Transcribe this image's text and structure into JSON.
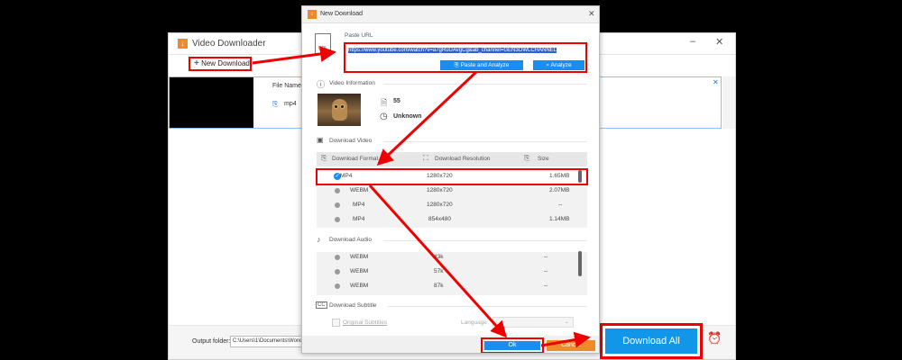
{
  "background_window": {
    "title": "Video Downloader",
    "minimize_glyph": "–",
    "close_glyph": "✕",
    "new_download_label": "New Download",
    "new_download_icon": "plus-icon",
    "item": {
      "file_name_label": "File Name:",
      "format": "mp4",
      "format_icon": "video-file-icon",
      "close_glyph": "✕"
    },
    "output_folder_label": "Output folder:",
    "output_folder_value": "C:\\Users\\1\\Documents\\Wonde",
    "download_all_label": "Download All",
    "alarm_icon": "alarm-clock-icon"
  },
  "dialog": {
    "title": "New Download",
    "close_glyph": "✕",
    "paste_url_label": "Paste URL",
    "url_value": "https://www.youtube.com/watch?v=a7gRuUAvgCg&ab_channel=GEN3OWLCHANNEL",
    "paste_and_analyze_label": "Paste and Analyze",
    "analyze_label": "Analyze",
    "video_information_label": "Video Information",
    "video_info": {
      "duration": "55",
      "size": "Unknown"
    },
    "download_video_label": "Download Video",
    "video_table": {
      "headers": [
        "Download Format",
        "Download Resolution",
        "Size"
      ],
      "rows": [
        {
          "format": "MP4",
          "resolution": "1280x720",
          "size": "1.65MB",
          "selected": true
        },
        {
          "format": "WEBM",
          "resolution": "1280x720",
          "size": "2.07MB",
          "selected": false
        },
        {
          "format": "MP4",
          "resolution": "1280x720",
          "size": "--",
          "selected": false
        },
        {
          "format": "MP4",
          "resolution": "854x480",
          "size": "1.14MB",
          "selected": false
        }
      ]
    },
    "download_audio_label": "Download Audio",
    "audio_table": {
      "rows": [
        {
          "format": "WEBM",
          "bitrate": "43k",
          "size": "--"
        },
        {
          "format": "WEBM",
          "bitrate": "57k",
          "size": "--"
        },
        {
          "format": "WEBM",
          "bitrate": "87k",
          "size": "--"
        }
      ]
    },
    "download_subtitle_label": "Download Subtitle",
    "original_subtitles_label": "Original Subtitles",
    "language_label": "Language",
    "ok_label": "Ok",
    "cancel_label": "Cancel"
  },
  "colors": {
    "accent_blue": "#1b8df0",
    "cancel_orange": "#f08a24",
    "annotation_red": "#e00000"
  }
}
